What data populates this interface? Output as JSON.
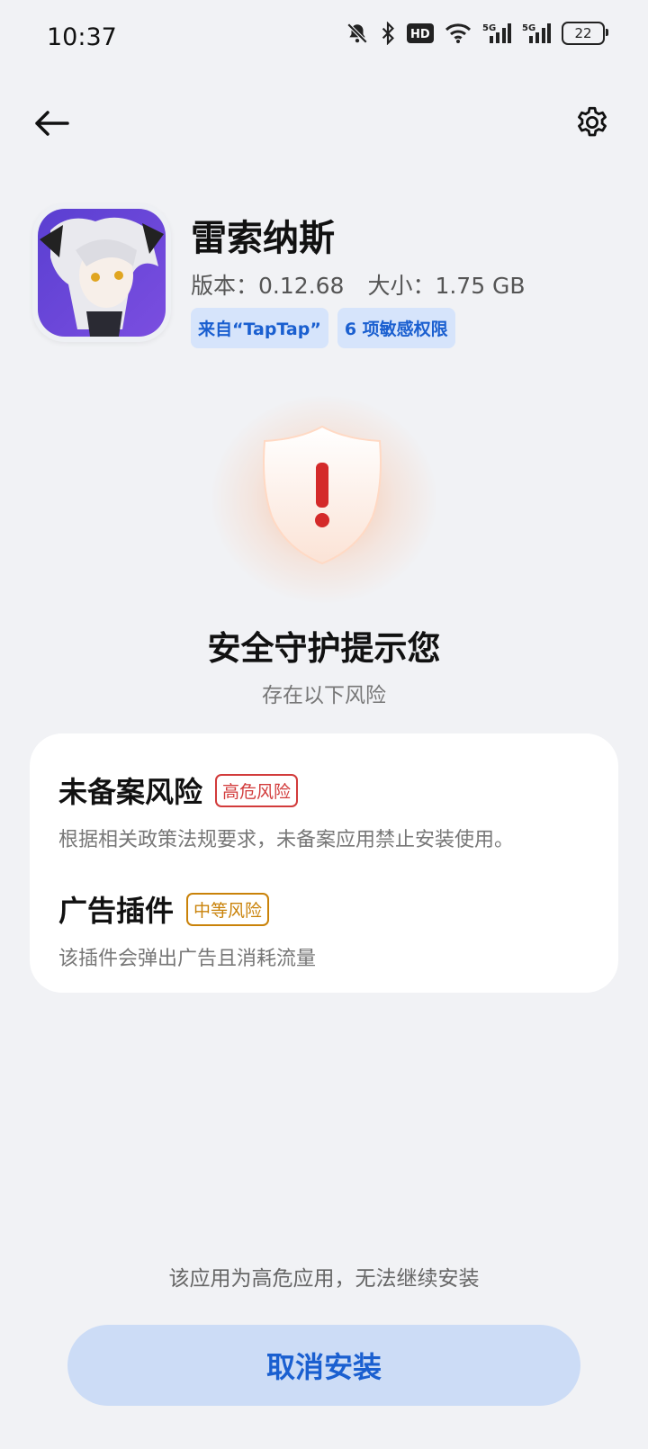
{
  "status_bar": {
    "time": "10:37",
    "icons": [
      "bell-off-icon",
      "bluetooth-icon",
      "hd-icon",
      "wifi-icon",
      "signal-5g-icon",
      "signal-5g-icon"
    ],
    "battery": "22"
  },
  "toolbar": {
    "back_icon": "back-arrow-icon",
    "settings_icon": "gear-icon"
  },
  "app": {
    "name": "雷索纳斯",
    "version": "版本：0.12.68",
    "size": "大小：1.75 GB",
    "tags": [
      "来自“TapTap”",
      "6 项敏感权限"
    ]
  },
  "warning": {
    "title": "安全守护提示您",
    "subtitle": "存在以下风险"
  },
  "risks": [
    {
      "name": "未备案风险",
      "level": "高危风险",
      "desc": "根据相关政策法规要求，未备案应用禁止安装使用。"
    },
    {
      "name": "广告插件",
      "level": "中等风险",
      "desc": "该插件会弹出广告且消耗流量"
    }
  ],
  "footer": {
    "note": "该应用为高危应用，无法继续安装",
    "cancel_label": "取消安装"
  },
  "colors": {
    "accent": "#1a5fd0",
    "high_risk": "#d23b3b",
    "mid_risk": "#c98209",
    "background": "#f1f2f5"
  }
}
